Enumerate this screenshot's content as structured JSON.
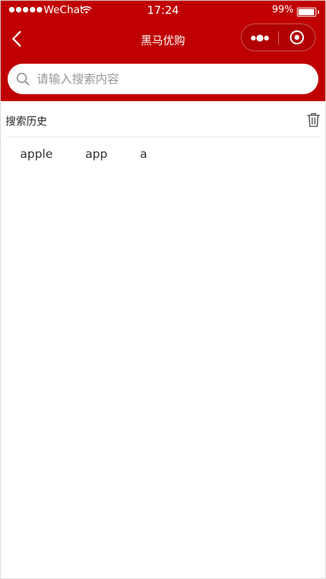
{
  "status_bar": {
    "carrier": "WeChat",
    "time": "17:24",
    "battery_percent": "99%",
    "battery_level": 0.99
  },
  "navbar": {
    "title": "黑马优购"
  },
  "search": {
    "placeholder": "请输入搜索内容",
    "value": ""
  },
  "history": {
    "title": "搜索历史",
    "items": [
      {
        "label": "apple"
      },
      {
        "label": "app"
      },
      {
        "label": "a"
      }
    ]
  },
  "colors": {
    "brand": "#c00000",
    "background": "#ffffff",
    "divider": "#ececec"
  },
  "icons": [
    "back-arrow-icon",
    "more-dots-icon",
    "record-close-icon",
    "search-icon",
    "trash-icon",
    "wifi-icon",
    "battery-icon"
  ]
}
